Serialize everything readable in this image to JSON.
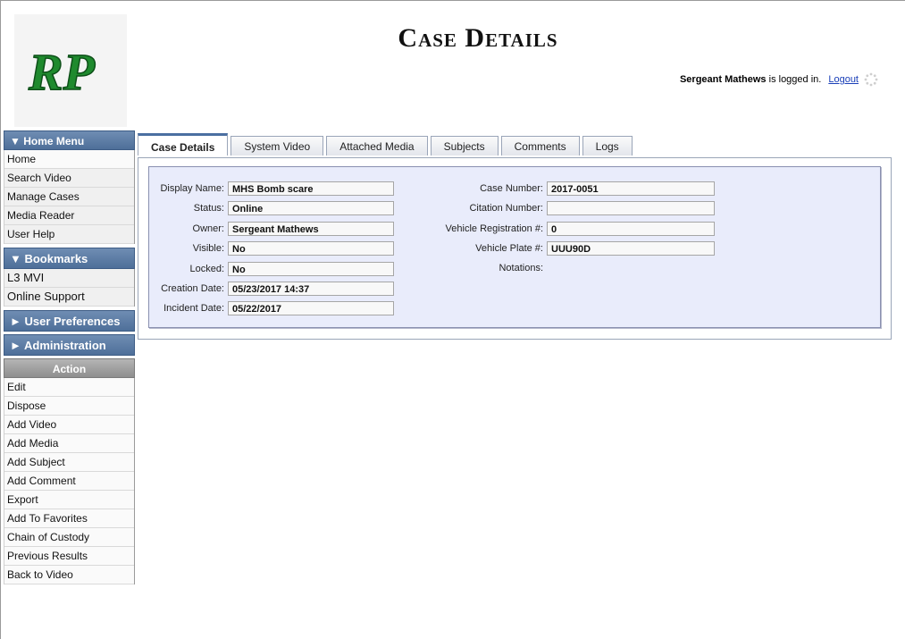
{
  "header": {
    "title": "Case Details",
    "user_name": "Sergeant Mathews",
    "logged_in_text": "is logged in.",
    "logout_label": "Logout",
    "logo_text": "RP",
    "logo_color": "#1f8a2e"
  },
  "sidebar": {
    "home_menu": {
      "title": "▼ Home Menu",
      "items": [
        "Home",
        "Search Video",
        "Manage Cases",
        "Media Reader",
        "User Help"
      ]
    },
    "bookmarks": {
      "title": "▼  Bookmarks",
      "items": [
        "L3 MVI",
        "Online Support"
      ]
    },
    "user_preferences": {
      "title": "► User Preferences"
    },
    "administration": {
      "title": "► Administration"
    },
    "action": {
      "title": "Action",
      "items": [
        "Edit",
        "Dispose",
        "Add Video",
        "Add Media",
        "Add Subject",
        "Add Comment",
        "Export",
        "Add To Favorites",
        "Chain of Custody",
        "Previous Results",
        "Back to Video"
      ]
    }
  },
  "tabs": [
    "Case Details",
    "System Video",
    "Attached Media",
    "Subjects",
    "Comments",
    "Logs"
  ],
  "details": {
    "left": [
      {
        "label": "Display Name:",
        "value": "MHS Bomb scare"
      },
      {
        "label": "Status:",
        "value": "Online"
      },
      {
        "label": "Owner:",
        "value": "Sergeant Mathews"
      },
      {
        "label": "Visible:",
        "value": "No"
      },
      {
        "label": "Locked:",
        "value": "No"
      },
      {
        "label": "Creation Date:",
        "value": "05/23/2017 14:37"
      },
      {
        "label": "Incident Date:",
        "value": "05/22/2017"
      }
    ],
    "right": [
      {
        "label": "Case Number:",
        "value": "2017-0051"
      },
      {
        "label": "Citation Number:",
        "value": ""
      },
      {
        "label": "Vehicle Registration #:",
        "value": "0"
      },
      {
        "label": "Vehicle Plate #:",
        "value": "UUU90D"
      }
    ],
    "notations_label": "Notations:"
  }
}
